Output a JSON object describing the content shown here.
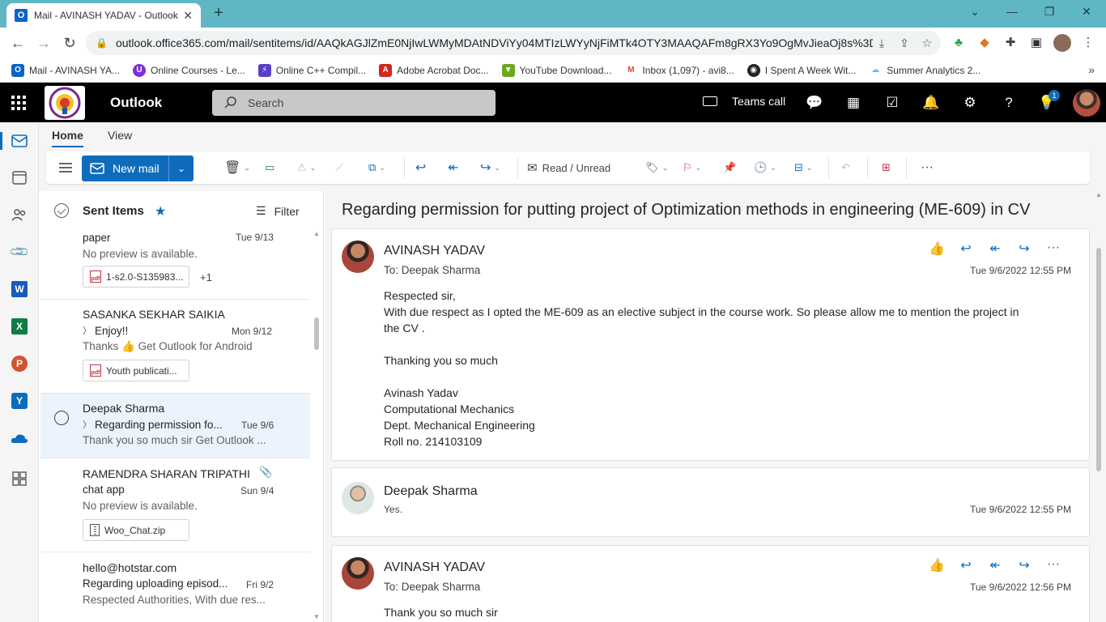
{
  "browser": {
    "tab_title": "Mail - AVINASH YADAV - Outlook",
    "url": "outlook.office365.com/mail/sentitems/id/AAQkAGJlZmE0NjIwLWMyMDAtNDViYy04MTIzLWYyNjFiMTk4OTY3MAAQAFm8gRX3Yo9OgMvJieaOj8s%3D",
    "bookmarks": [
      {
        "label": "Mail - AVINASH YA...",
        "color": "#0a64c9",
        "glyph": "O"
      },
      {
        "label": "Online Courses - Le...",
        "color": "#7b2fd6",
        "glyph": "U"
      },
      {
        "label": "Online C++ Compil...",
        "color": "#5b3ec8",
        "glyph": "⚡"
      },
      {
        "label": "Adobe Acrobat Doc...",
        "color": "#d4251c",
        "glyph": "A"
      },
      {
        "label": "YouTube Download...",
        "color": "#6aa81e",
        "glyph": "▼"
      },
      {
        "label": "Inbox (1,097) - avi8...",
        "color": "#ea4335",
        "glyph": "M"
      },
      {
        "label": "I Spent A Week Wit...",
        "color": "#222222",
        "glyph": "◉"
      },
      {
        "label": "Summer Analytics 2...",
        "color": "#7ab8d9",
        "glyph": "☁"
      }
    ]
  },
  "header": {
    "brand": "Outlook",
    "search_placeholder": "Search",
    "teams_label": "Teams call",
    "notification_count": "1"
  },
  "ribbon": {
    "tabs": [
      "Home",
      "View"
    ],
    "new_mail": "New mail",
    "read_unread": "Read / Unread"
  },
  "list": {
    "folder": "Sent Items",
    "filter": "Filter",
    "messages": [
      {
        "from": "",
        "subject": "paper",
        "date": "Tue 9/13",
        "preview": "No preview is available.",
        "attachment": "1-s2.0-S135983...",
        "extra": "+1"
      },
      {
        "from": "SASANKA SEKHAR SAIKIA",
        "subject": "Enjoy!!",
        "date": "Mon 9/12",
        "preview": "Thanks 👍 Get Outlook for Android",
        "attachment": "Youth publicati..."
      },
      {
        "from": "Deepak Sharma",
        "subject": "Regarding permission fo...",
        "date": "Tue 9/6",
        "preview": "Thank you so much sir Get Outlook ..."
      },
      {
        "from": "RAMENDRA SHARAN TRIPATHI",
        "subject": "chat app",
        "date": "Sun 9/4",
        "preview": "No preview is available.",
        "attachment": "Woo_Chat.zip"
      },
      {
        "from": "hello@hotstar.com",
        "subject": "Regarding uploading episod...",
        "date": "Fri 9/2",
        "preview": "Respected Authorities, With due res..."
      }
    ]
  },
  "reading": {
    "subject": "Regarding permission for putting project of Optimization methods in engineering (ME-609) in CV",
    "messages": [
      {
        "sender": "AVINASH YADAV",
        "to": "To:  Deepak Sharma",
        "time": "Tue 9/6/2022 12:55 PM",
        "body": [
          "Respected sir,",
          "With due respect as I opted the ME-609 as an elective subject in the course work.  So please allow me to mention the project in",
          "the CV .",
          "",
          "Thanking you so much",
          "",
          "Avinash Yadav",
          "Computational Mechanics",
          "Dept. Mechanical Engineering",
          "Roll no. 214103109"
        ]
      },
      {
        "sender": "Deepak Sharma",
        "preview": "Yes.",
        "time": "Tue 9/6/2022 12:55 PM"
      },
      {
        "sender": "AVINASH YADAV",
        "to": "To:  Deepak Sharma",
        "time": "Tue 9/6/2022 12:56 PM",
        "body_first": "Thank you so much sir"
      }
    ]
  },
  "colors": {
    "accent": "#0f6cbd",
    "chrome": "#5fb7c4",
    "header": "#000000"
  }
}
